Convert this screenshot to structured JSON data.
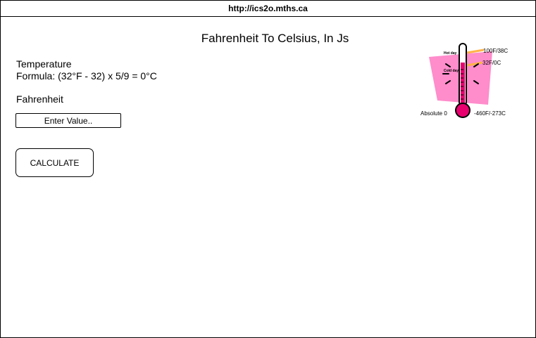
{
  "browser": {
    "url": "http://ics2o.mths.ca"
  },
  "page": {
    "title": "Fahrenheit To Celsius, In Js",
    "temperature_label": "Temperature",
    "formula": "Formula: (32°F - 32) x 5/9 = 0°C",
    "fahrenheit_label": "Fahrenheit",
    "input": {
      "placeholder": "Enter Value..",
      "value": ""
    },
    "calculate_button": "CALCULATE"
  },
  "thermometer_image": {
    "labels": {
      "hot": "100F/38C",
      "freeze": "32F/0C",
      "absolute_zero": "Absolute 0",
      "bottom": "-460F/-273C",
      "hot_day": "Hot day",
      "cold_day": "Cold day"
    },
    "colors": {
      "background_pink": "#ff78c2",
      "bulb_pink": "#e8006f",
      "marker_orange": "#ffb347"
    }
  }
}
